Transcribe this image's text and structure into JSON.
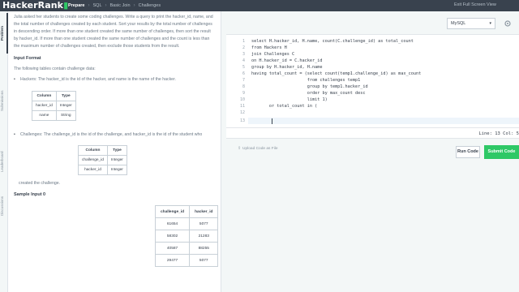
{
  "header": {
    "logo_main": "HackerRank",
    "logo_accent": "▮",
    "breadcrumbs": [
      "Prepare",
      "SQL",
      "Basic Join",
      "Challenges"
    ],
    "exit_label": "Exit Full Screen View"
  },
  "side_tabs": [
    "Problem",
    "Submissions",
    "Leaderboard",
    "Discussions"
  ],
  "problem": {
    "intro": "Julia asked her students to create some coding challenges. Write a query to print the hacker_id, name, and the total number of challenges created by each student. Sort your results by the total number of challenges in descending order. If more than one student created the same number of challenges, then sort the result by hacker_id. If more than one student created the same number of challenges and the count is less than the maximum number of challenges created, then exclude those students from the result.",
    "input_format_heading": "Input Format",
    "tables_intro": "The following tables contain challenge data:",
    "hackers_desc": "Hackers: The hacker_id is the id of the hacker, and name is the name of the hacker.",
    "hackers_table": {
      "headers": [
        "Column",
        "Type"
      ],
      "rows": [
        [
          "hacker_id",
          "Integer"
        ],
        [
          "name",
          "String"
        ]
      ]
    },
    "challenges_desc": "Challenges: The challenge_id is the id of the challenge, and hacker_id is the id of the student who",
    "challenges_table": {
      "headers": [
        "Column",
        "Type"
      ],
      "rows": [
        [
          "challenge_id",
          "Integer"
        ],
        [
          "hacker_id",
          "Integer"
        ]
      ]
    },
    "created_text": "created the challenge.",
    "sample_heading": "Sample Input 0",
    "sample_table": {
      "headers": [
        "challenge_id",
        "hacker_id"
      ],
      "rows": [
        [
          "61654",
          "5077"
        ],
        [
          "58302",
          "21283"
        ],
        [
          "40587",
          "88255"
        ],
        [
          "29477",
          "5077"
        ]
      ]
    }
  },
  "editor": {
    "language": "MySQL",
    "line_numbers": [
      "1",
      "2",
      "3",
      "4",
      "5",
      "6",
      "7",
      "8",
      "9",
      "10",
      "11",
      "12",
      "13"
    ],
    "code_lines": [
      "select H.hacker_id, H.name, count(C.challenge_id) as total_count",
      "from Hackers H",
      "join Challenges C",
      "on H.hacker_id = C.hacker_id",
      "group by H.hacker_id, H.name",
      "having total_count = (select count(temp1.challenge_id) as max_count",
      "                      from challenges temp1",
      "                      group by temp1.hacker_id",
      "                      order by max_count desc",
      "                      limit 1)",
      "       or total_count in (",
      "",
      ""
    ],
    "status": "Line: 13 Col: 5",
    "upload_label": "Upload Code as File",
    "run_label": "Run Code",
    "submit_label": "Submit Code"
  }
}
